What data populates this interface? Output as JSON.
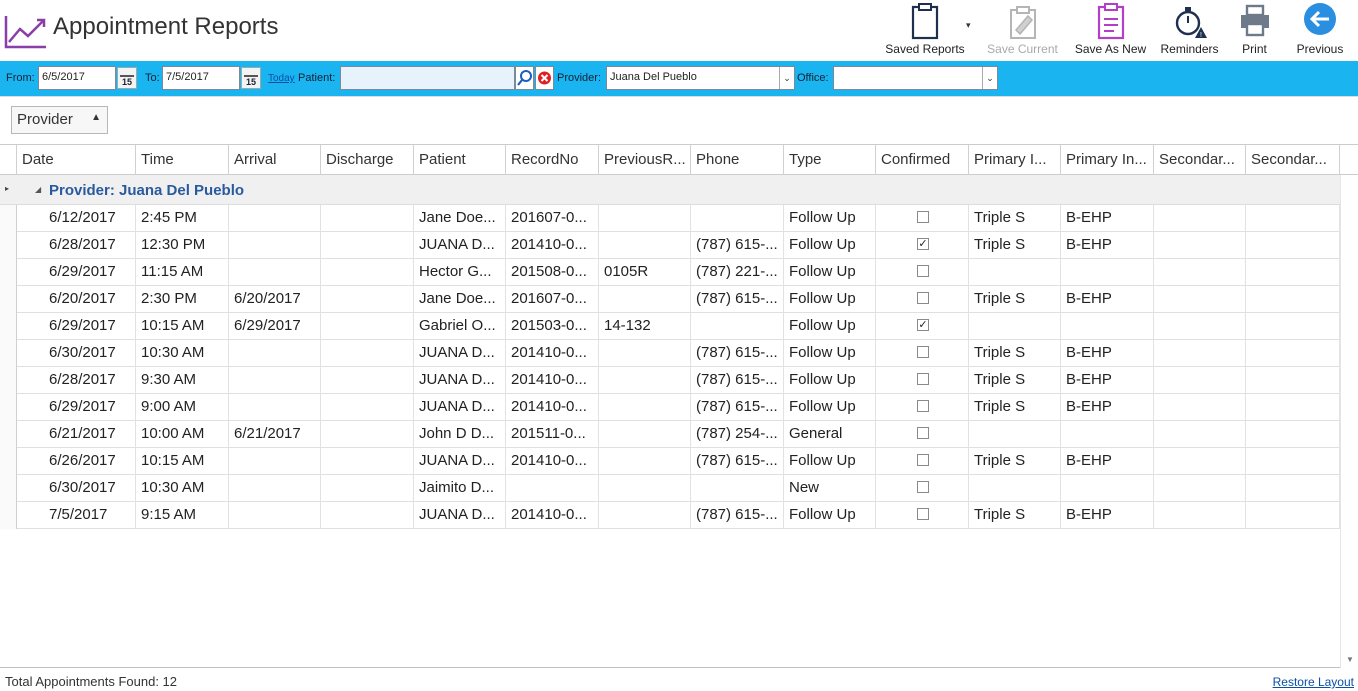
{
  "app": {
    "title": "Appointment Reports"
  },
  "toolbar": {
    "saved_reports": "Saved Reports",
    "save_current": "Save Current",
    "save_as_new": "Save As New",
    "reminders": "Reminders",
    "print": "Print",
    "previous": "Previous"
  },
  "filters": {
    "from_label": "From:",
    "from_value": "6/5/2017",
    "to_label": "To:",
    "to_value": "7/5/2017",
    "calendar_day": "15",
    "today_link": "Today",
    "patient_label": "Patient:",
    "patient_value": "",
    "provider_label": "Provider:",
    "provider_value": "Juana Del Pueblo",
    "office_label": "Office:",
    "office_value": ""
  },
  "grouping": {
    "chip_label": "Provider"
  },
  "grid": {
    "columns": [
      "Date",
      "Time",
      "Arrival",
      "Discharge",
      "Patient",
      "RecordNo",
      "PreviousR...",
      "Phone",
      "Type",
      "Confirmed",
      "Primary I...",
      "Primary In...",
      "Secondar...",
      "Secondar..."
    ],
    "group_label": "Provider: Juana Del Pueblo",
    "rows": [
      {
        "date": "6/12/2017",
        "time": "2:45 PM",
        "arrival": "",
        "discharge": "",
        "patient": "Jane  Doe...",
        "record": "201607-0...",
        "prev": "",
        "phone": "",
        "type": "Follow Up",
        "confirmed": false,
        "pri1": "Triple S",
        "pri2": "B-EHP",
        "sec1": "",
        "sec2": ""
      },
      {
        "date": "6/28/2017",
        "time": "12:30 PM",
        "arrival": "",
        "discharge": "",
        "patient": "JUANA  D...",
        "record": "201410-0...",
        "prev": "",
        "phone": "(787) 615-...",
        "type": "Follow Up",
        "confirmed": true,
        "pri1": "Triple S",
        "pri2": "B-EHP",
        "sec1": "",
        "sec2": ""
      },
      {
        "date": "6/29/2017",
        "time": "11:15 AM",
        "arrival": "",
        "discharge": "",
        "patient": "Hector  G...",
        "record": "201508-0...",
        "prev": "0105R",
        "phone": "(787) 221-...",
        "type": "Follow Up",
        "confirmed": false,
        "pri1": "",
        "pri2": "",
        "sec1": "",
        "sec2": ""
      },
      {
        "date": "6/20/2017",
        "time": "2:30 PM",
        "arrival": "6/20/2017",
        "discharge": "",
        "patient": "Jane  Doe...",
        "record": "201607-0...",
        "prev": "",
        "phone": "(787) 615-...",
        "type": "Follow Up",
        "confirmed": false,
        "pri1": "Triple S",
        "pri2": "B-EHP",
        "sec1": "",
        "sec2": ""
      },
      {
        "date": "6/29/2017",
        "time": "10:15 AM",
        "arrival": "6/29/2017",
        "discharge": "",
        "patient": "Gabriel  O...",
        "record": "201503-0...",
        "prev": "14-132",
        "phone": "",
        "type": "Follow Up",
        "confirmed": true,
        "pri1": "",
        "pri2": "",
        "sec1": "",
        "sec2": ""
      },
      {
        "date": "6/30/2017",
        "time": "10:30 AM",
        "arrival": "",
        "discharge": "",
        "patient": "JUANA  D...",
        "record": "201410-0...",
        "prev": "",
        "phone": "(787) 615-...",
        "type": "Follow Up",
        "confirmed": false,
        "pri1": "Triple S",
        "pri2": "B-EHP",
        "sec1": "",
        "sec2": ""
      },
      {
        "date": "6/28/2017",
        "time": "9:30 AM",
        "arrival": "",
        "discharge": "",
        "patient": "JUANA  D...",
        "record": "201410-0...",
        "prev": "",
        "phone": "(787) 615-...",
        "type": "Follow Up",
        "confirmed": false,
        "pri1": "Triple S",
        "pri2": "B-EHP",
        "sec1": "",
        "sec2": ""
      },
      {
        "date": "6/29/2017",
        "time": "9:00 AM",
        "arrival": "",
        "discharge": "",
        "patient": "JUANA D...",
        "record": "201410-0...",
        "prev": "",
        "phone": "(787) 615-...",
        "type": "Follow Up",
        "confirmed": false,
        "pri1": "Triple S",
        "pri2": "B-EHP",
        "sec1": "",
        "sec2": ""
      },
      {
        "date": "6/21/2017",
        "time": "10:00 AM",
        "arrival": "6/21/2017",
        "discharge": "",
        "patient": "John  D D...",
        "record": "201511-0...",
        "prev": "",
        "phone": "(787) 254-...",
        "type": "General",
        "confirmed": false,
        "pri1": "",
        "pri2": "",
        "sec1": "",
        "sec2": ""
      },
      {
        "date": "6/26/2017",
        "time": "10:15 AM",
        "arrival": "",
        "discharge": "",
        "patient": "JUANA D...",
        "record": "201410-0...",
        "prev": "",
        "phone": "(787) 615-...",
        "type": "Follow Up",
        "confirmed": false,
        "pri1": "Triple S",
        "pri2": "B-EHP",
        "sec1": "",
        "sec2": ""
      },
      {
        "date": "6/30/2017",
        "time": "10:30 AM",
        "arrival": "",
        "discharge": "",
        "patient": "Jaimito D...",
        "record": "",
        "prev": "",
        "phone": "",
        "type": "New",
        "confirmed": false,
        "pri1": "",
        "pri2": "",
        "sec1": "",
        "sec2": ""
      },
      {
        "date": "7/5/2017",
        "time": "9:15 AM",
        "arrival": "",
        "discharge": "",
        "patient": "JUANA  D...",
        "record": "201410-0...",
        "prev": "",
        "phone": "(787) 615-...",
        "type": "Follow Up",
        "confirmed": false,
        "pri1": "Triple S",
        "pri2": "B-EHP",
        "sec1": "",
        "sec2": ""
      }
    ]
  },
  "footer": {
    "total": "Total Appointments Found: 12",
    "restore_layout": "Restore Layout"
  },
  "colors": {
    "accent": "#1ab4f0",
    "group_text": "#2a5a9e",
    "reports_icon": "#8a3fa8"
  }
}
